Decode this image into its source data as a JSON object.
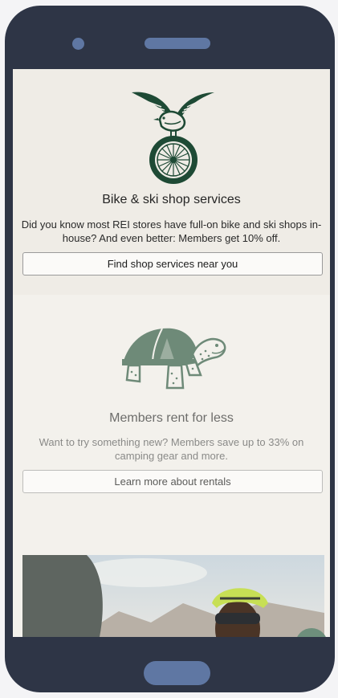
{
  "shop_services": {
    "title": "Bike & ski shop services",
    "description": "Did you know most REI stores have full-on bike and ski shops in-house? And even better: Members get 10% off.",
    "button_label": "Find shop services near you"
  },
  "rentals": {
    "title": "Members rent for less",
    "description": "Want to try something new? Members save up to 33% on camping gear and more.",
    "button_label": "Learn more about rentals"
  },
  "colors": {
    "device": "#2e3546",
    "device_accent": "#5f77a3",
    "illustration_dark": "#1e4a35",
    "illustration_sage": "#6e8a78"
  }
}
